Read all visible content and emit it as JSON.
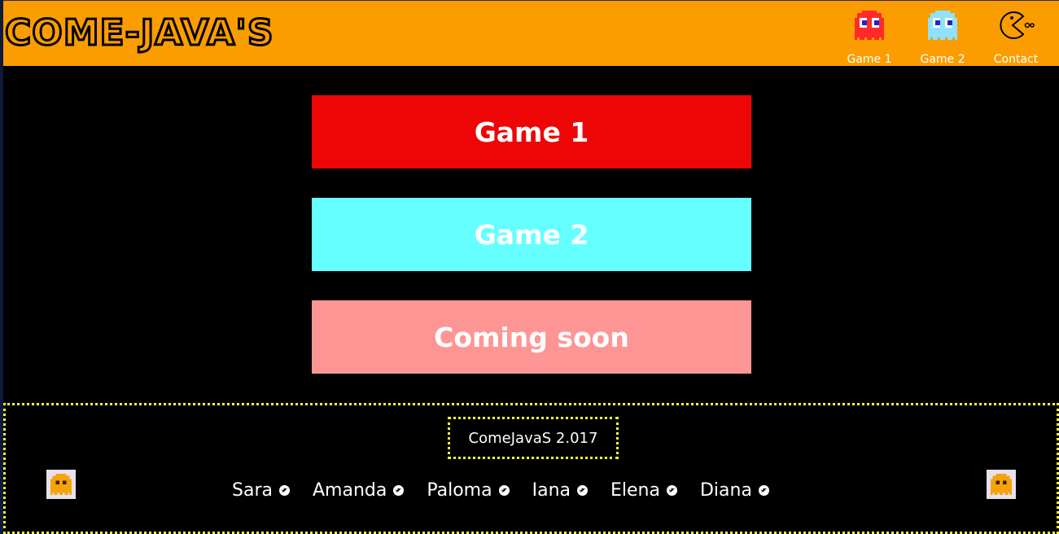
{
  "header": {
    "logo_text": "COME-JAVA'S",
    "background": "#fb9d00"
  },
  "nav": {
    "items": [
      {
        "label": "Game 1",
        "icon": "red-ghost-icon"
      },
      {
        "label": "Game 2",
        "icon": "blue-ghost-icon"
      },
      {
        "label": "Contact",
        "icon": "pacman-icon"
      }
    ]
  },
  "main": {
    "buttons": [
      {
        "label": "Game 1",
        "color": "#ee0505"
      },
      {
        "label": "Game 2",
        "color": "#66ffff"
      },
      {
        "label": "Coming soon",
        "color": "#fe9595"
      }
    ]
  },
  "footer": {
    "copyright": "ComeJavaS 2.017",
    "border_color": "#ffff33",
    "authors": [
      {
        "name": "Sara",
        "icon": "twitter-icon"
      },
      {
        "name": "Amanda",
        "icon": "twitter-icon"
      },
      {
        "name": "Paloma",
        "icon": "twitter-icon"
      },
      {
        "name": "Iana",
        "icon": "twitter-icon"
      },
      {
        "name": "Elena",
        "icon": "twitter-icon"
      },
      {
        "name": "Diana",
        "icon": "twitter-icon"
      }
    ]
  }
}
